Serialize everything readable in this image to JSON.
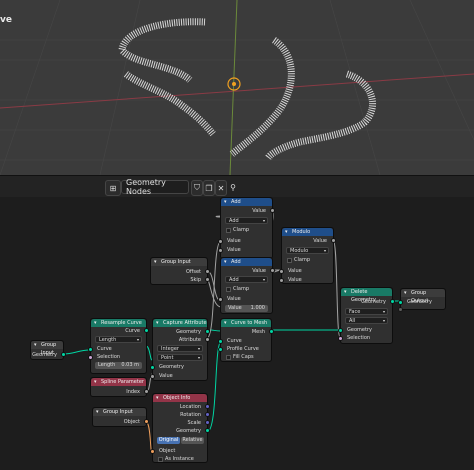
{
  "viewport": {
    "mode_label": "ve"
  },
  "header": {
    "editor_icon": "node-tree-icon",
    "tree_name": "Geometry Nodes",
    "pin_icon": "pin-icon"
  },
  "nodes": {
    "add1": {
      "title": "Add",
      "out": "Value",
      "op": "Add",
      "clamp": "Clamp",
      "in1": "Value",
      "in2": "Value"
    },
    "add2": {
      "title": "Add",
      "out": "Value",
      "op": "Add",
      "clamp": "Clamp",
      "in1": "Value",
      "in2_label": "Value",
      "in2_val": "1.000"
    },
    "modulo": {
      "title": "Modulo",
      "out": "Value",
      "op": "Modulo",
      "clamp": "Clamp",
      "in1": "Value",
      "in2": "Value"
    },
    "group_input_top": {
      "title": "Group Input",
      "out1": "Offset",
      "out2": "Skip"
    },
    "group_input_left": {
      "title": "Group Input",
      "out1": "Geometry"
    },
    "resample": {
      "title": "Resample Curve",
      "out": "Curve",
      "mode": "Length",
      "in1": "Curve",
      "in2": "Selection",
      "len_label": "Length",
      "len_val": "0.03 m"
    },
    "spline_param": {
      "title": "Spline Parameter",
      "out": "Index"
    },
    "capture": {
      "title": "Capture Attribute",
      "out1": "Geometry",
      "out2": "Attribute",
      "type": "Integer",
      "domain": "Point",
      "in1": "Geometry",
      "in2": "Value"
    },
    "curve_to_mesh": {
      "title": "Curve to Mesh",
      "out": "Mesh",
      "in1": "Curve",
      "in2": "Profile Curve",
      "in3": "Fill Caps"
    },
    "delete_geo": {
      "title": "Delete Geometry",
      "out": "Geometry",
      "domain": "Face",
      "mode": "All",
      "in1": "Geometry",
      "in2": "Selection"
    },
    "group_output": {
      "title": "Group Output",
      "in1": "Geometry"
    },
    "group_input_bottom": {
      "title": "Group Input",
      "out1": "Object"
    },
    "object_info": {
      "title": "Object Info",
      "out1": "Location",
      "out2": "Rotation",
      "out3": "Scale",
      "out4": "Geometry",
      "tab1": "Original",
      "tab2": "Relative",
      "in1": "Object",
      "in2": "As Instance"
    }
  }
}
